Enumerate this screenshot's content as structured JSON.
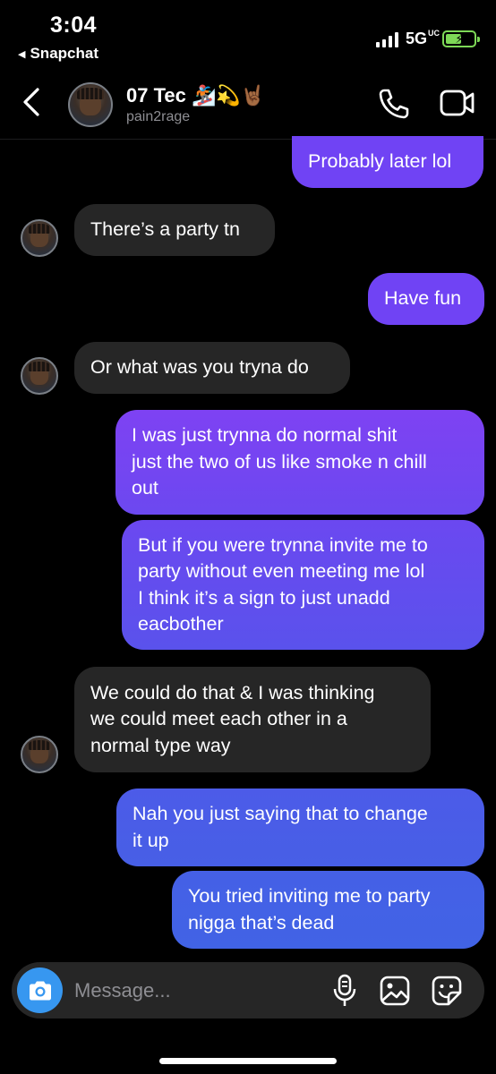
{
  "status_bar": {
    "time": "3:04",
    "back_app": "Snapchat",
    "network": "5G",
    "network_suffix": "UC",
    "signal_bars": 4,
    "battery_level": 0.55,
    "battery_color": "#7ed957"
  },
  "header": {
    "contact_name": "07 Tec 🏂💫🤘🏾",
    "username": "pain2rage",
    "icons": [
      "chevron-left-icon",
      "avatar",
      "phone-icon",
      "video-camera-icon"
    ]
  },
  "colors": {
    "outgoing_top": "#8a40f0",
    "outgoing_bottom": "#4a5ee6",
    "incoming": "#262626",
    "accent": "#3797f0"
  },
  "messages": [
    {
      "direction": "outgoing",
      "lines": [
        "Probably later lol"
      ]
    },
    {
      "direction": "incoming",
      "lines": [
        "There’s a party tn"
      ]
    },
    {
      "direction": "outgoing",
      "lines": [
        "Have fun"
      ]
    },
    {
      "direction": "incoming",
      "lines": [
        "Or what was you tryna do"
      ]
    },
    {
      "direction": "outgoing",
      "lines": [
        "I was just trynna do normal shit",
        "just the two of us like smoke n chill",
        "out"
      ]
    },
    {
      "direction": "outgoing",
      "lines": [
        "But if you were trynna invite me to",
        "party without even meeting me lol",
        "I think it’s a sign to just unadd",
        "eacbother"
      ]
    },
    {
      "direction": "incoming",
      "lines": [
        "We could do that & I was thinking",
        "we could meet each other in a",
        "normal type way"
      ]
    },
    {
      "direction": "outgoing",
      "lines": [
        "Nah you just saying that to change",
        "it up"
      ]
    },
    {
      "direction": "outgoing",
      "lines": [
        "You tried inviting me to party",
        "nigga that’s dead"
      ]
    }
  ],
  "composer": {
    "placeholder": "Message...",
    "icons": [
      "camera-icon",
      "microphone-icon",
      "gallery-icon",
      "sticker-icon"
    ]
  }
}
